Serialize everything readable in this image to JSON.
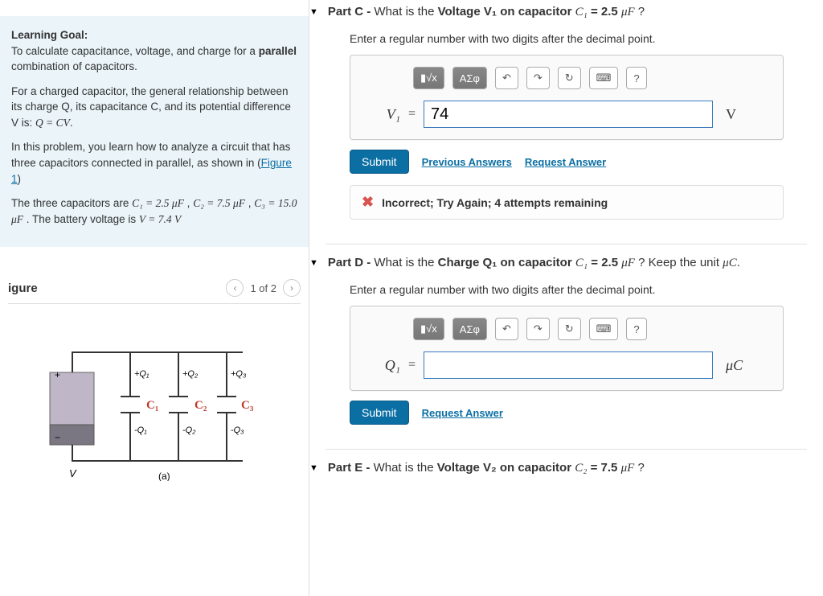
{
  "sidebar": {
    "learning_goal_label": "Learning Goal:",
    "learning_goal_text": "To calculate capacitance, voltage, and charge for a ",
    "learning_goal_bold": "parallel",
    "learning_goal_text2": " combination of capacitors.",
    "para2_a": "For a charged capacitor, the general relationship between its charge Q, its capacitance C, and its potential difference V is: ",
    "para2_eq": "Q = CV",
    "para2_b": ".",
    "para3_a": "In this problem, you learn how to analyze a circuit that has three capacitors connected in parallel, as shown in (",
    "figure_link": "Figure 1",
    "para3_b": ")",
    "para4_a": "The three capacitors are ",
    "c1": "C₁ = 2.5 μF",
    "sep1": " , ",
    "c2": "C₂ = 7.5 μF",
    "sep2": " , ",
    "c3": "C₃ = 15.0 μF",
    "para4_b": " . The battery voltage is ",
    "v_eq": "V = 7.4 V",
    "figure_title": "igure",
    "pager_text": "1 of 2",
    "fig_caption": "(a)",
    "fig_vlabel": "V",
    "cap_labels": {
      "c1": "C₁",
      "c2": "C₂",
      "c3": "C₃"
    }
  },
  "partC": {
    "prefix": "Part C - ",
    "q1": "What is the ",
    "bold1": "Voltage V₁ on capacitor ",
    "cap": "C₁",
    "eq": " = 2.5 ",
    "unit": "μF",
    "suffix": " ?",
    "hint": "Enter a regular number with two digits after the decimal point.",
    "var_label": "V₁",
    "value": "74",
    "unit_after": "V",
    "submit": "Submit",
    "prev": "Previous Answers",
    "req": "Request Answer",
    "feedback": "Incorrect; Try Again; 4 attempts remaining"
  },
  "partD": {
    "prefix": "Part D - ",
    "q1": "What is the ",
    "bold1": "Charge Q₁ on capacitor ",
    "cap": "C₁",
    "eq": " = 2.5 ",
    "unit": "μF",
    "suffix": " ? Keep the unit ",
    "unit2": "μC",
    "suffix2": ".",
    "hint": "Enter a regular number with two digits after the decimal point.",
    "var_label": "Q₁",
    "value": "",
    "unit_after": "μC",
    "submit": "Submit",
    "req": "Request Answer"
  },
  "partE": {
    "prefix": "Part E - ",
    "q1": "What is the ",
    "bold1": "Voltage V₂ on capacitor ",
    "cap": "C₂",
    "eq": " = 7.5 ",
    "unit": "μF",
    "suffix": " ?"
  },
  "toolbar": {
    "format": "▮√x",
    "greek": "ΑΣφ",
    "help": "?"
  }
}
